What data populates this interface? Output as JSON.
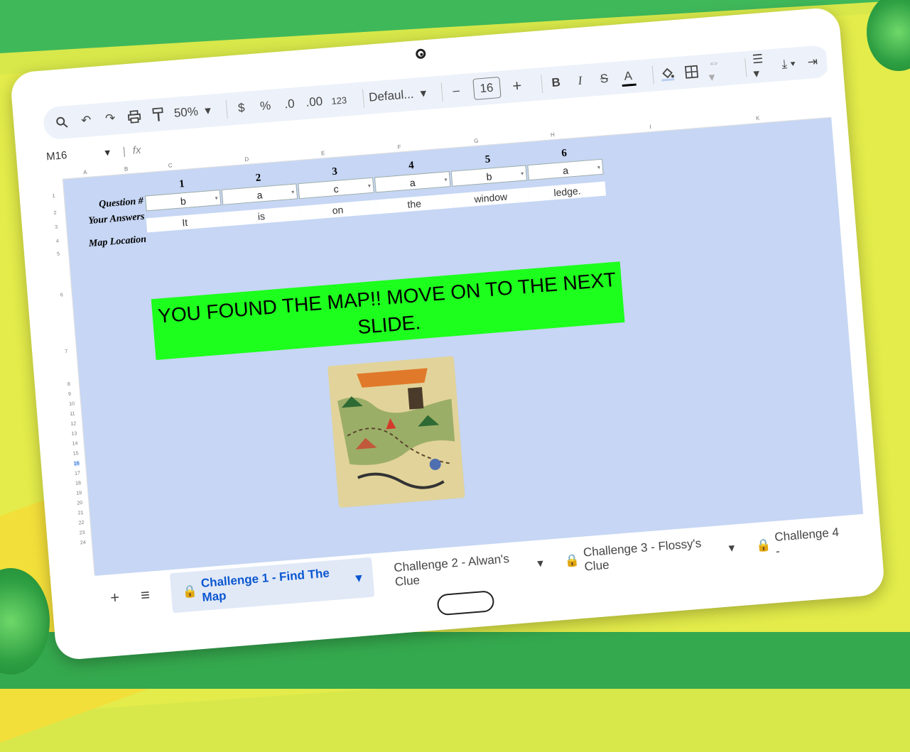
{
  "toolbar": {
    "zoom": "50%",
    "currency": "$",
    "percent": "%",
    "decrease_decimal": ".0",
    "increase_decimal": ".00",
    "number_format": "123",
    "font": "Defaul...",
    "minus": "–",
    "font_size": "16",
    "plus": "+",
    "bold": "B",
    "italic": "I",
    "strike": "S",
    "text_color": "A"
  },
  "formula_bar": {
    "cell_ref": "M16",
    "fx": "fx"
  },
  "column_headers": [
    "A",
    "B",
    "C",
    "D",
    "E",
    "F",
    "G",
    "H",
    "I",
    "K"
  ],
  "row_headers": [
    "1",
    "2",
    "3",
    "4",
    "5",
    "6",
    "7",
    "8",
    "9",
    "10",
    "11",
    "12",
    "13",
    "14",
    "15",
    "16",
    "17",
    "18",
    "19",
    "20",
    "21",
    "22",
    "23",
    "24"
  ],
  "sheet": {
    "label_question": "Question #",
    "label_answers": "Your Answers",
    "label_map": "Map Location",
    "question_numbers": [
      "1",
      "2",
      "3",
      "4",
      "5",
      "6"
    ],
    "answers": [
      "b",
      "a",
      "c",
      "a",
      "b",
      "a"
    ],
    "map_words": [
      "It",
      "is",
      "on",
      "the",
      "window",
      "ledge."
    ],
    "banner": "YOU FOUND THE MAP!! MOVE ON TO THE NEXT SLIDE.",
    "banner_color": "#1dff1d",
    "sheet_background": "#c6d6f4"
  },
  "tabs": {
    "add": "+",
    "menu": "≡",
    "items": [
      {
        "label": "Challenge 1 - Find The Map",
        "locked": true,
        "active": true
      },
      {
        "label": "Challenge 2 - Alwan's Clue",
        "locked": false,
        "active": false
      },
      {
        "label": "Challenge 3 - Flossy's Clue",
        "locked": true,
        "active": false
      },
      {
        "label": "Challenge 4 -",
        "locked": true,
        "active": false
      }
    ]
  }
}
